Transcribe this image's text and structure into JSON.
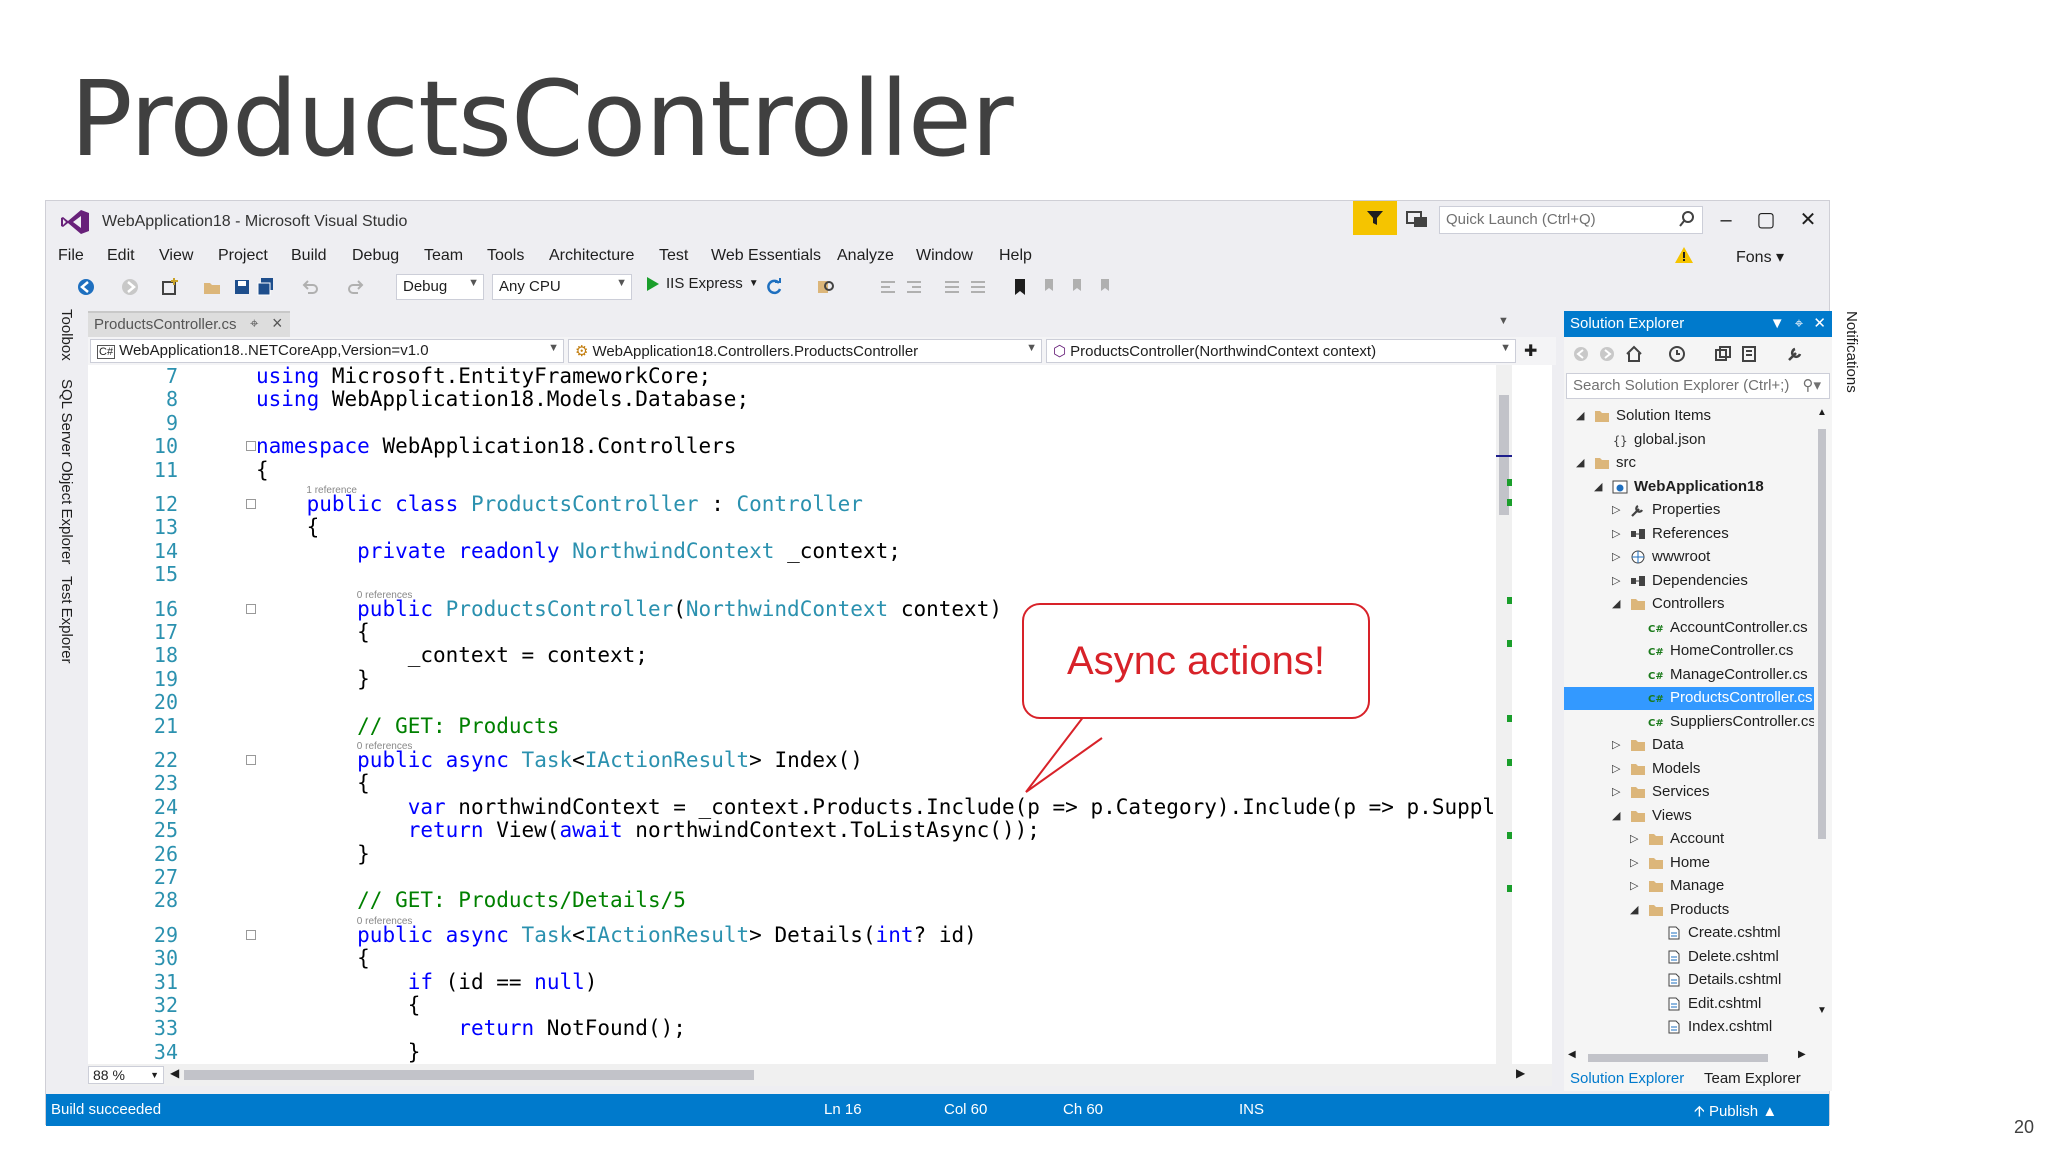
{
  "slide": {
    "title": "ProductsController",
    "page_number": "20"
  },
  "window": {
    "title": "WebApplication18 - Microsoft Visual Studio",
    "quick_launch_placeholder": "Quick Launch (Ctrl+Q)",
    "user": "Fons"
  },
  "menu": [
    "File",
    "Edit",
    "View",
    "Project",
    "Build",
    "Debug",
    "Team",
    "Tools",
    "Architecture",
    "Test",
    "Web Essentials",
    "Analyze",
    "Window",
    "Help"
  ],
  "toolbar": {
    "config": "Debug",
    "platform": "Any CPU",
    "run_target": "IIS Express"
  },
  "side_tabs": [
    "Toolbox",
    "SQL Server Object Explorer",
    "Test Explorer"
  ],
  "editor": {
    "tab_label": "ProductsController.cs",
    "nav_project": "WebApplication18..NETCoreApp,Version=v1.0",
    "nav_type": "WebApplication18.Controllers.ProductsController",
    "nav_member": "ProductsController(NorthwindContext context)",
    "zoom": "88 %",
    "lines": [
      {
        "n": "7",
        "text": "using Microsoft.EntityFrameworkCore;"
      },
      {
        "n": "8",
        "text": "using WebApplication18.Models.Database;"
      },
      {
        "n": "9",
        "text": ""
      },
      {
        "n": "10",
        "text": "namespace WebApplication18.Controllers"
      },
      {
        "n": "11",
        "text": "{"
      },
      {
        "n": "12",
        "lens": "1 reference",
        "text": "    public class ProductsController : Controller"
      },
      {
        "n": "13",
        "text": "    {"
      },
      {
        "n": "14",
        "text": "        private readonly NorthwindContext _context;"
      },
      {
        "n": "15",
        "text": ""
      },
      {
        "n": "16",
        "lens": "0 references",
        "text": "        public ProductsController(NorthwindContext context)"
      },
      {
        "n": "17",
        "text": "        {"
      },
      {
        "n": "18",
        "text": "            _context = context;"
      },
      {
        "n": "19",
        "text": "        }"
      },
      {
        "n": "20",
        "text": ""
      },
      {
        "n": "21",
        "text": "        // GET: Products"
      },
      {
        "n": "22",
        "lens": "0 references",
        "text": "        public async Task<IActionResult> Index()"
      },
      {
        "n": "23",
        "text": "        {"
      },
      {
        "n": "24",
        "text": "            var northwindContext = _context.Products.Include(p => p.Category).Include(p => p.Suppl"
      },
      {
        "n": "25",
        "text": "            return View(await northwindContext.ToListAsync());"
      },
      {
        "n": "26",
        "text": "        }"
      },
      {
        "n": "27",
        "text": ""
      },
      {
        "n": "28",
        "text": "        // GET: Products/Details/5"
      },
      {
        "n": "29",
        "lens": "0 references",
        "text": "        public async Task<IActionResult> Details(int? id)"
      },
      {
        "n": "30",
        "text": "        {"
      },
      {
        "n": "31",
        "text": "            if (id == null)"
      },
      {
        "n": "32",
        "text": "            {"
      },
      {
        "n": "33",
        "text": "                return NotFound();"
      },
      {
        "n": "34",
        "text": "            }"
      }
    ]
  },
  "callout": {
    "text": "Async actions!"
  },
  "solution_explorer": {
    "title": "Solution Explorer",
    "search_placeholder": "Search Solution Explorer (Ctrl+;)",
    "items": [
      {
        "label": "Solution Items",
        "depth": 0,
        "exp": "open",
        "icon": "folder"
      },
      {
        "label": "global.json",
        "depth": 1,
        "exp": "",
        "icon": "json"
      },
      {
        "label": "src",
        "depth": 0,
        "exp": "open",
        "icon": "folder"
      },
      {
        "label": "WebApplication18",
        "depth": 1,
        "exp": "open",
        "icon": "project",
        "bold": true
      },
      {
        "label": "Properties",
        "depth": 2,
        "exp": "closed",
        "icon": "wrench"
      },
      {
        "label": "References",
        "depth": 2,
        "exp": "closed",
        "icon": "refs"
      },
      {
        "label": "wwwroot",
        "depth": 2,
        "exp": "closed",
        "icon": "globe"
      },
      {
        "label": "Dependencies",
        "depth": 2,
        "exp": "closed",
        "icon": "refs"
      },
      {
        "label": "Controllers",
        "depth": 2,
        "exp": "open",
        "icon": "folder"
      },
      {
        "label": "AccountController.cs",
        "depth": 3,
        "exp": "",
        "icon": "cs"
      },
      {
        "label": "HomeController.cs",
        "depth": 3,
        "exp": "",
        "icon": "cs"
      },
      {
        "label": "ManageController.cs",
        "depth": 3,
        "exp": "",
        "icon": "cs"
      },
      {
        "label": "ProductsController.cs",
        "depth": 3,
        "exp": "",
        "icon": "cs",
        "selected": true
      },
      {
        "label": "SuppliersController.cs",
        "depth": 3,
        "exp": "",
        "icon": "cs"
      },
      {
        "label": "Data",
        "depth": 2,
        "exp": "closed",
        "icon": "folder"
      },
      {
        "label": "Models",
        "depth": 2,
        "exp": "closed",
        "icon": "folder"
      },
      {
        "label": "Services",
        "depth": 2,
        "exp": "closed",
        "icon": "folder"
      },
      {
        "label": "Views",
        "depth": 2,
        "exp": "open",
        "icon": "folder"
      },
      {
        "label": "Account",
        "depth": 3,
        "exp": "closed",
        "icon": "folder"
      },
      {
        "label": "Home",
        "depth": 3,
        "exp": "closed",
        "icon": "folder"
      },
      {
        "label": "Manage",
        "depth": 3,
        "exp": "closed",
        "icon": "folder"
      },
      {
        "label": "Products",
        "depth": 3,
        "exp": "open",
        "icon": "folder"
      },
      {
        "label": "Create.cshtml",
        "depth": 4,
        "exp": "",
        "icon": "file"
      },
      {
        "label": "Delete.cshtml",
        "depth": 4,
        "exp": "",
        "icon": "file"
      },
      {
        "label": "Details.cshtml",
        "depth": 4,
        "exp": "",
        "icon": "file"
      },
      {
        "label": "Edit.cshtml",
        "depth": 4,
        "exp": "",
        "icon": "file"
      },
      {
        "label": "Index.cshtml",
        "depth": 4,
        "exp": "",
        "icon": "file"
      }
    ],
    "tabs": [
      "Solution Explorer",
      "Team Explorer"
    ]
  },
  "notifications_label": "Notifications",
  "status": {
    "message": "Build succeeded",
    "line": "Ln 16",
    "col": "Col 60",
    "ch": "Ch 60",
    "mode": "INS",
    "publish": "Publish"
  },
  "colors": {
    "accent": "#007acc",
    "keyword": "#0000ff",
    "type": "#2b91af",
    "comment": "#008000",
    "callout": "#d82229",
    "filter": "#f5c400"
  }
}
